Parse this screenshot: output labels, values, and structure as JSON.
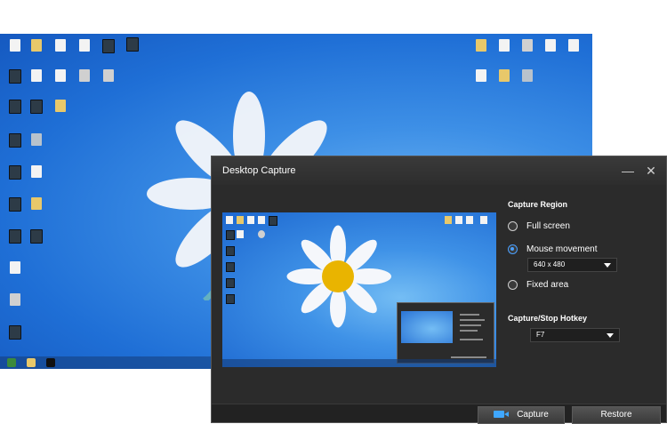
{
  "dialog": {
    "title": "Desktop Capture",
    "minimize_glyph": "—",
    "close_glyph": "✕",
    "capture_region_label": "Capture Region",
    "options": [
      {
        "label": "Full screen",
        "checked": false
      },
      {
        "label": "Mouse movement",
        "checked": true
      },
      {
        "label": "Fixed area",
        "checked": false
      }
    ],
    "mouse_movement_size": "640 x 480",
    "hotkey_label": "Capture/Stop Hotkey",
    "hotkey_value": "F7",
    "capture_button": "Capture",
    "restore_button": "Restore"
  },
  "icons": {
    "camera": "camera-icon",
    "dropdown": "chevron-down-icon"
  },
  "colors": {
    "accent": "#4aa0ff",
    "dialog_bg": "#2b2b2b",
    "desktop_blue": "#3d8fe6"
  }
}
